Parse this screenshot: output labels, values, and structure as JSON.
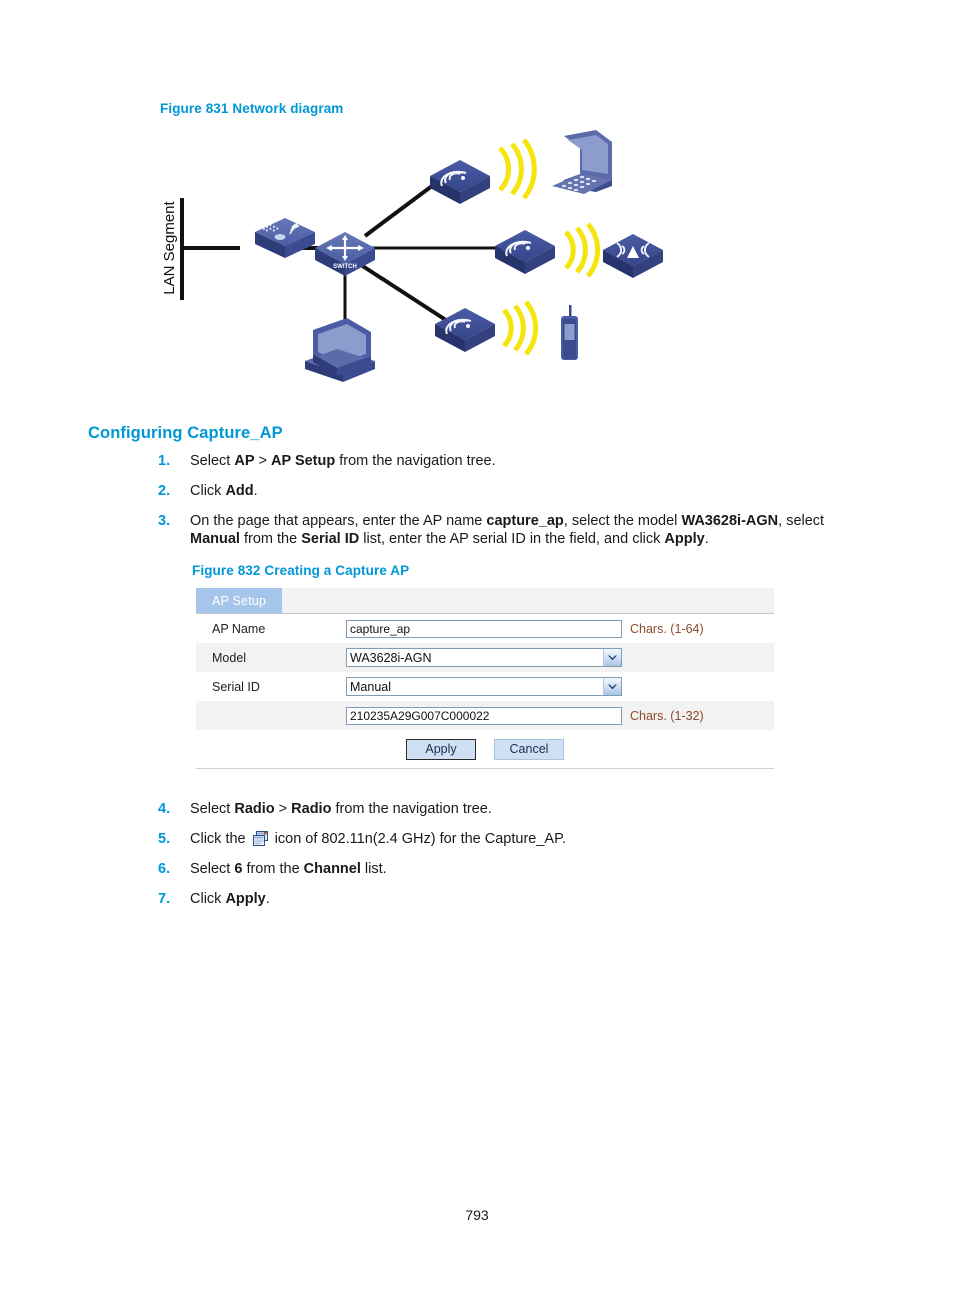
{
  "document": {
    "page_number": "793"
  },
  "figure_831": {
    "caption": "Figure 831 Network diagram",
    "lan_segment_label": "LAN Segment",
    "switch_label": "SWITCH",
    "nodes": [
      {
        "name": "lan-segment-bar",
        "type": "vertical-line"
      },
      {
        "name": "gateway-device",
        "type": "wireless-gateway"
      },
      {
        "name": "core-switch",
        "type": "switch"
      },
      {
        "name": "ap-top",
        "type": "access-point"
      },
      {
        "name": "ap-middle",
        "type": "access-point"
      },
      {
        "name": "ap-bottom",
        "type": "access-point"
      },
      {
        "name": "laptop-client",
        "type": "laptop"
      },
      {
        "name": "desktop-client",
        "type": "desktop-pc"
      },
      {
        "name": "wireless-client-device",
        "type": "wireless-terminal"
      },
      {
        "name": "handheld-phone-client",
        "type": "mobile-phone"
      }
    ]
  },
  "section": {
    "heading": "Configuring Capture_AP"
  },
  "steps_top": [
    {
      "number": "1.",
      "html": "Select <b>AP</b> &gt; <b>AP Setup</b> from the navigation tree."
    },
    {
      "number": "2.",
      "html": "Click <b>Add</b>."
    },
    {
      "number": "3.",
      "html": "On the page that appears, enter the AP name <b>capture_ap</b>, select the model <b>WA3628i-AGN</b>, select <b>Manual</b> from the <b>Serial ID</b> list, enter the AP serial ID in the field, and click <b>Apply</b>."
    }
  ],
  "steps_bottom": [
    {
      "number": "4.",
      "html": "Select <b>Radio</b> &gt; <b>Radio</b> from the navigation tree."
    },
    {
      "number": "5.",
      "html": "Click the <span class=\"inline-icon\" data-name=\"radio-settings-icon\" data-interactable=\"false\"><svg width=\"17\" height=\"17\" viewBox=\"0 0 17 17\"><rect x=\"4.5\" y=\"1.5\" width=\"11\" height=\"9\" fill=\"#dfe9f6\" stroke=\"#2b4f86\" stroke-width=\"1\"/><rect x=\"5.5\" y=\"2.5\" width=\"9\" height=\"2\" fill=\"#8fb0da\"/><rect x=\"12\" y=\"1.8\" width=\"2.6\" height=\"2.6\" fill=\"#c0392b\"/><rect x=\"1.5\" y=\"5.5\" width=\"11\" height=\"10\" fill=\"#eef4fb\" stroke=\"#2b4f86\" stroke-width=\"1\"/><rect x=\"2.5\" y=\"6.5\" width=\"9\" height=\"2\" fill=\"#8fb0da\"/><rect x=\"2.6\" y=\"9.6\" width=\"8.8\" height=\"1\" fill=\"#9fb8d8\"/><rect x=\"2.6\" y=\"11.4\" width=\"8.8\" height=\"1\" fill=\"#9fb8d8\"/><rect x=\"2.6\" y=\"13.2\" width=\"6\" height=\"1\" fill=\"#9fb8d8\"/></svg></span> icon of 802.11n(2.4 GHz) for the Capture_AP."
    },
    {
      "number": "6.",
      "html": "Select <b>6</b> from the <b>Channel</b> list."
    },
    {
      "number": "7.",
      "html": "Click <b>Apply</b>."
    }
  ],
  "figure_832": {
    "caption": "Figure 832 Creating a Capture AP",
    "tab_label": "AP Setup",
    "rows": [
      {
        "label": "AP Name",
        "control": "text",
        "value": "capture_ap",
        "hint": "Chars. (1-64)"
      },
      {
        "label": "Model",
        "control": "select",
        "value": "WA3628i-AGN",
        "hint": ""
      },
      {
        "label": "Serial ID",
        "control": "select",
        "value": "Manual",
        "hint": ""
      },
      {
        "label": "",
        "control": "text",
        "value": "210235A29G007C000022",
        "hint": "Chars. (1-32)"
      }
    ],
    "buttons": {
      "apply": "Apply",
      "cancel": "Cancel"
    }
  },
  "colors": {
    "accent_blue": "#0097d6",
    "tab_blue": "#a6c5ea",
    "device_blue": "#3c4f96",
    "signal_yellow": "#f5e400",
    "hint_brown": "#8a4b2a"
  }
}
